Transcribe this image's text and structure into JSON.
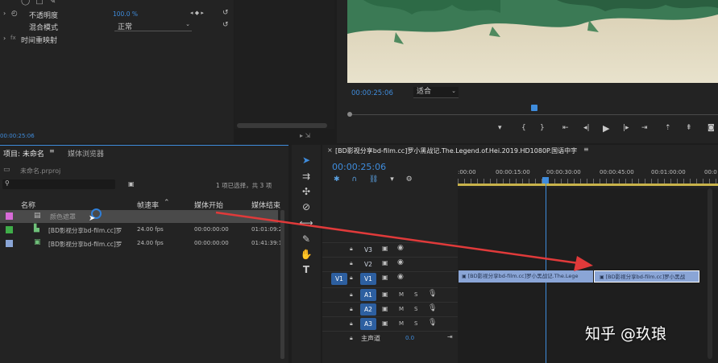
{
  "effects": {
    "opacity_label": "不透明度",
    "opacity_value": "100.0 %",
    "blend_label": "混合模式",
    "blend_value": "正常",
    "time_remap_label": "时间重映射",
    "timecode": "00:00:25:06"
  },
  "monitor": {
    "timecode": "00:00:25:06",
    "fit_value": "适合"
  },
  "project": {
    "tab_project": "项目: 未命名",
    "tab_media_browser": "媒体浏览器",
    "filename": "未命名.prproj",
    "selection_status": "1 项已选择，共 3 项",
    "columns": [
      "名称",
      "帧速率",
      "媒体开始",
      "媒体结束"
    ],
    "items": [
      {
        "name": "颜色遮罩",
        "fps": "",
        "start": "",
        "end": "",
        "color": "#d86bd8"
      },
      {
        "name": "[BD影视分享bd-film.cc]罗",
        "fps": "24.00 fps",
        "start": "00:00:00:00",
        "end": "01:01:09:2",
        "color": "#3fae49"
      },
      {
        "name": "[BD影视分享bd-film.cc]罗",
        "fps": "24.00 fps",
        "start": "00:00:00:00",
        "end": "01:41:39:1",
        "color": "#8aa5d6"
      }
    ]
  },
  "timeline": {
    "sequence_title": "[BD影视分享bd-film.cc]罗小黑战记.The.Legend.of.Hei.2019.HD1080P.国语中字",
    "timecode": "00:00:25:06",
    "ruler": [
      ":00:00",
      "00:00:15:00",
      "00:00:30:00",
      "00:00:45:00",
      "00:01:00:00",
      "00:0"
    ],
    "video_tracks": [
      "V3",
      "V2",
      "V1"
    ],
    "audio_tracks": [
      "A1",
      "A2",
      "A3"
    ],
    "source_v1": "V1",
    "master_label": "主声道",
    "master_value": "0.0",
    "clip1_text": "[BD影视分享bd-film.cc]罗小黑战记.The.Lege",
    "clip2_text": "[BD影视分享bd-film.cc]罗小黑战"
  },
  "watermark": "知乎 @玖琅",
  "colors": {
    "accent": "#3f8cdc",
    "clip": "#8aa5d6",
    "arrow": "#e03a3a"
  }
}
